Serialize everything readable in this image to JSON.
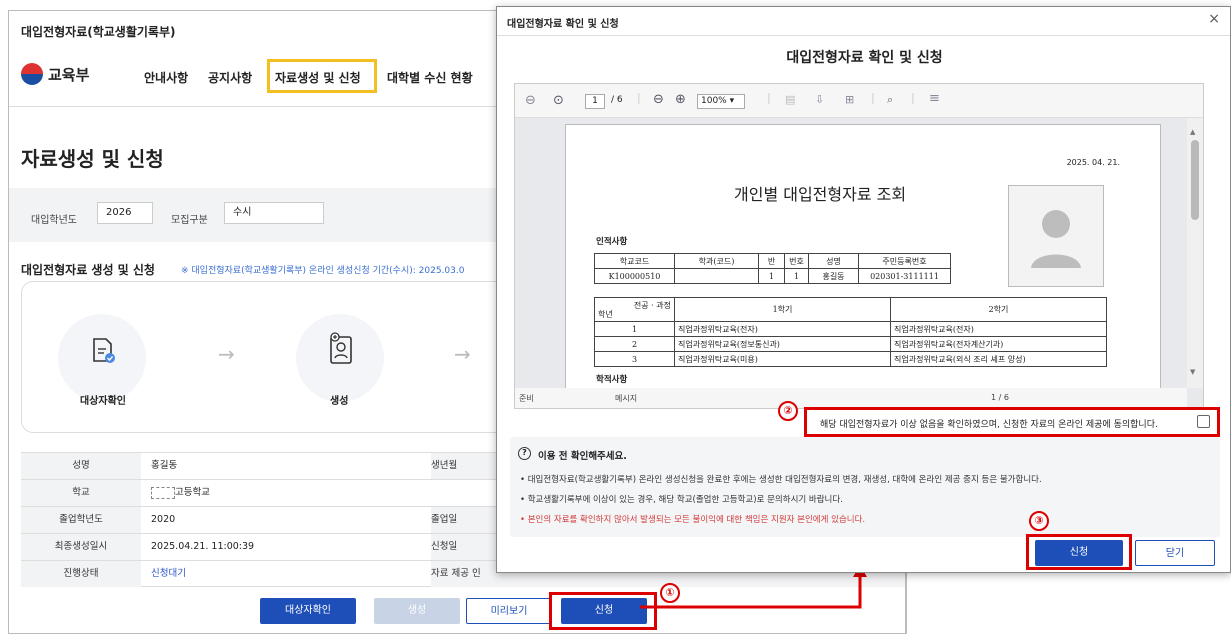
{
  "bg": {
    "title": "대입전형자료(학교생활기록부)",
    "logo": "교육부",
    "nav": [
      "안내사항",
      "공지사항",
      "자료생성 및 신청",
      "대학별 수신 현황"
    ],
    "page_title": "자료생성 및 신청",
    "filter": {
      "year_label": "대입학년도",
      "year_value": "2026",
      "type_label": "모집구분",
      "type_value": "수시"
    },
    "section_title": "대입전형자료 생성 및 신청",
    "section_note": "※ 대입전형자료(학교생활기록부) 온라인 생성신청 기간(수시): 2025.03.0",
    "steps": [
      {
        "label": "대상자확인"
      },
      {
        "label": "생성"
      }
    ],
    "arrow": "→",
    "info": [
      {
        "k": "성명",
        "v": "홍길동",
        "k2": "생년월"
      },
      {
        "k": "학교",
        "v": "고등학교",
        "k2": ""
      },
      {
        "k": "졸업학년도",
        "v": "2020",
        "k2": "졸업일"
      },
      {
        "k": "최종생성일시",
        "v": "2025.04.21. 11:00:39",
        "k2": "신청일"
      },
      {
        "k": "진행상태",
        "v": "신청대기",
        "k2": "자료 제공 인"
      }
    ],
    "buttons": {
      "confirm": "대상자확인",
      "create": "생성",
      "preview": "미리보기",
      "apply": "신청"
    }
  },
  "badges": {
    "one": "①",
    "two": "②",
    "three": "③"
  },
  "modal": {
    "title": "대입전형자료 확인 및 신청",
    "close": "×",
    "heading": "대입전형자료 확인 및 신청",
    "viewer": {
      "page": "1",
      "total": "/ 6",
      "zoom": "100%",
      "status_left": "준비",
      "status_mid": "메시지",
      "status_right": "1 / 6"
    },
    "doc": {
      "date": "2025. 04. 21.",
      "title": "개인별 대입전형자료 조회",
      "section1": "인적사항",
      "headers": [
        "학교코드",
        "학과(코드)",
        "반",
        "번호",
        "성명",
        "주민등록번호"
      ],
      "row": [
        "K100000510",
        "",
        "1",
        "1",
        "홍길동",
        "020301-3111111"
      ],
      "course_header": "전공 · 과정",
      "grade_label": "학년",
      "sem1": "1학기",
      "sem2": "2학기",
      "courses": [
        [
          "1",
          "직업과정위탁교육(전자)",
          "직업과정위탁교육(전자)"
        ],
        [
          "2",
          "직업과정위탁교육(정보통신과)",
          "직업과정위탁교육(전자계산기과)"
        ],
        [
          "3",
          "직업과정위탁교육(미용)",
          "직업과정위탁교육(외식 조리 셰프 양성)"
        ]
      ],
      "section2": "학적사항"
    },
    "agree_text": "해당 대입전형자료가 이상 없음을 확인하였으며, 신청한 자료의 온라인 제공에 동의합니다.",
    "notice": {
      "title": "이용 전 확인해주세요.",
      "lines": [
        "• 대입전형자료(학교생활기록부) 온라인 생성신청을 완료한 후에는 생성한 대입전형자료의 변경, 재생성, 대학에 온라인 제공 중지 등은 불가합니다.",
        "• 학교생활기록부에 이상이 있는 경우, 해당 학교(졸업한 고등학교)로 문의하시기 바랍니다.",
        "• 본인의 자료를 확인하지 않아서 발생되는 모든 불이익에 대한 책임은 지원자 본인에게 있습니다."
      ]
    },
    "buttons": {
      "apply": "신청",
      "close": "닫기"
    }
  }
}
